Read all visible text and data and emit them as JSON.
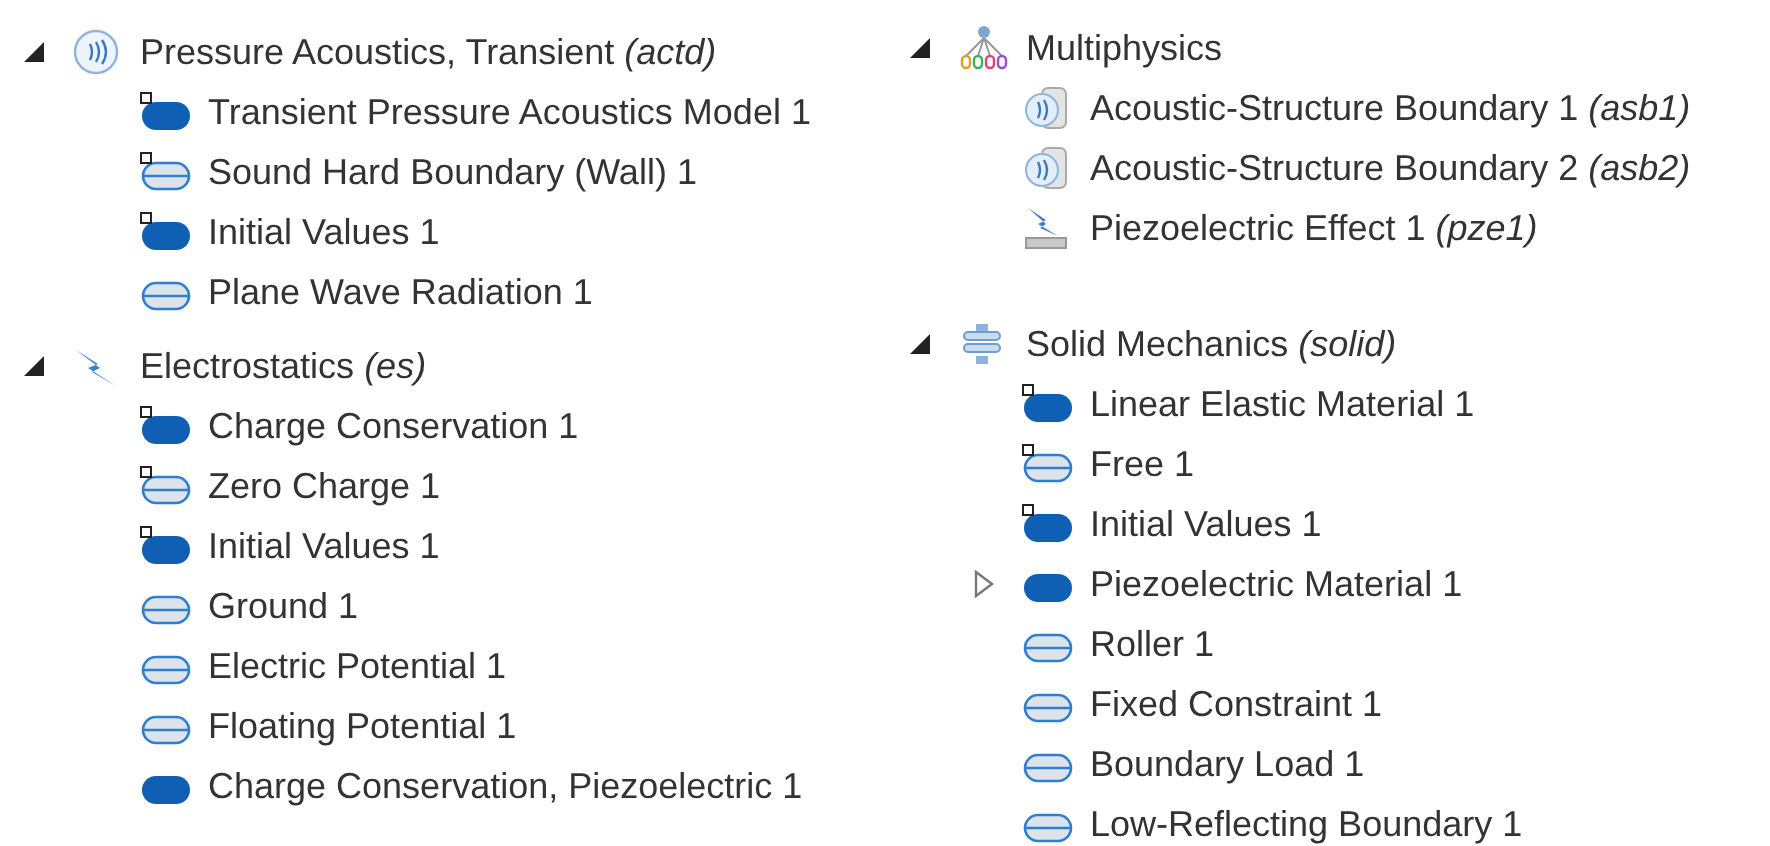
{
  "columns": [
    {
      "sections": [
        {
          "label": "Pressure Acoustics, Transient",
          "tag": "(actd)",
          "kind": "acoustics",
          "expanded": true,
          "children": [
            {
              "label": "Transient Pressure Acoustics Model 1",
              "kind": "domain",
              "default": true
            },
            {
              "label": "Sound Hard Boundary (Wall) 1",
              "kind": "boundary",
              "default": true
            },
            {
              "label": "Initial Values 1",
              "kind": "domain",
              "default": true
            },
            {
              "label": "Plane Wave Radiation 1",
              "kind": "boundary",
              "default": false
            }
          ]
        },
        {
          "label": "Electrostatics",
          "tag": "(es)",
          "kind": "electrostatics",
          "expanded": true,
          "children": [
            {
              "label": "Charge Conservation 1",
              "kind": "domain",
              "default": true
            },
            {
              "label": "Zero Charge 1",
              "kind": "boundary",
              "default": true
            },
            {
              "label": "Initial Values 1",
              "kind": "domain",
              "default": true
            },
            {
              "label": "Ground 1",
              "kind": "boundary",
              "default": false
            },
            {
              "label": "Electric Potential 1",
              "kind": "boundary",
              "default": false
            },
            {
              "label": "Floating Potential 1",
              "kind": "boundary",
              "default": false
            },
            {
              "label": "Charge Conservation, Piezoelectric 1",
              "kind": "domain",
              "default": false
            }
          ]
        }
      ]
    },
    {
      "sections": [
        {
          "label": "Multiphysics",
          "kind": "multiphysics",
          "expanded": true,
          "children": [
            {
              "label": "Acoustic-Structure Boundary 1",
              "tag": "(asb1)",
              "kind": "coupling"
            },
            {
              "label": "Acoustic-Structure Boundary 2",
              "tag": "(asb2)",
              "kind": "coupling"
            },
            {
              "label": "Piezoelectric Effect 1",
              "tag": "(pze1)",
              "kind": "piezo"
            }
          ]
        },
        {
          "label": "Solid Mechanics",
          "tag": "(solid)",
          "kind": "solid",
          "expanded": true,
          "children": [
            {
              "label": "Linear Elastic Material 1",
              "kind": "domain",
              "default": true
            },
            {
              "label": "Free 1",
              "kind": "boundary",
              "default": true
            },
            {
              "label": "Initial Values 1",
              "kind": "domain",
              "default": true
            },
            {
              "label": "Piezoelectric Material 1",
              "kind": "domain",
              "default": false,
              "expanded": false
            },
            {
              "label": "Roller 1",
              "kind": "boundary",
              "default": false
            },
            {
              "label": "Fixed Constraint 1",
              "kind": "boundary",
              "default": false
            },
            {
              "label": "Boundary Load 1",
              "kind": "boundary",
              "default": false
            },
            {
              "label": "Low-Reflecting Boundary 1",
              "kind": "boundary",
              "default": false
            }
          ]
        }
      ]
    }
  ]
}
